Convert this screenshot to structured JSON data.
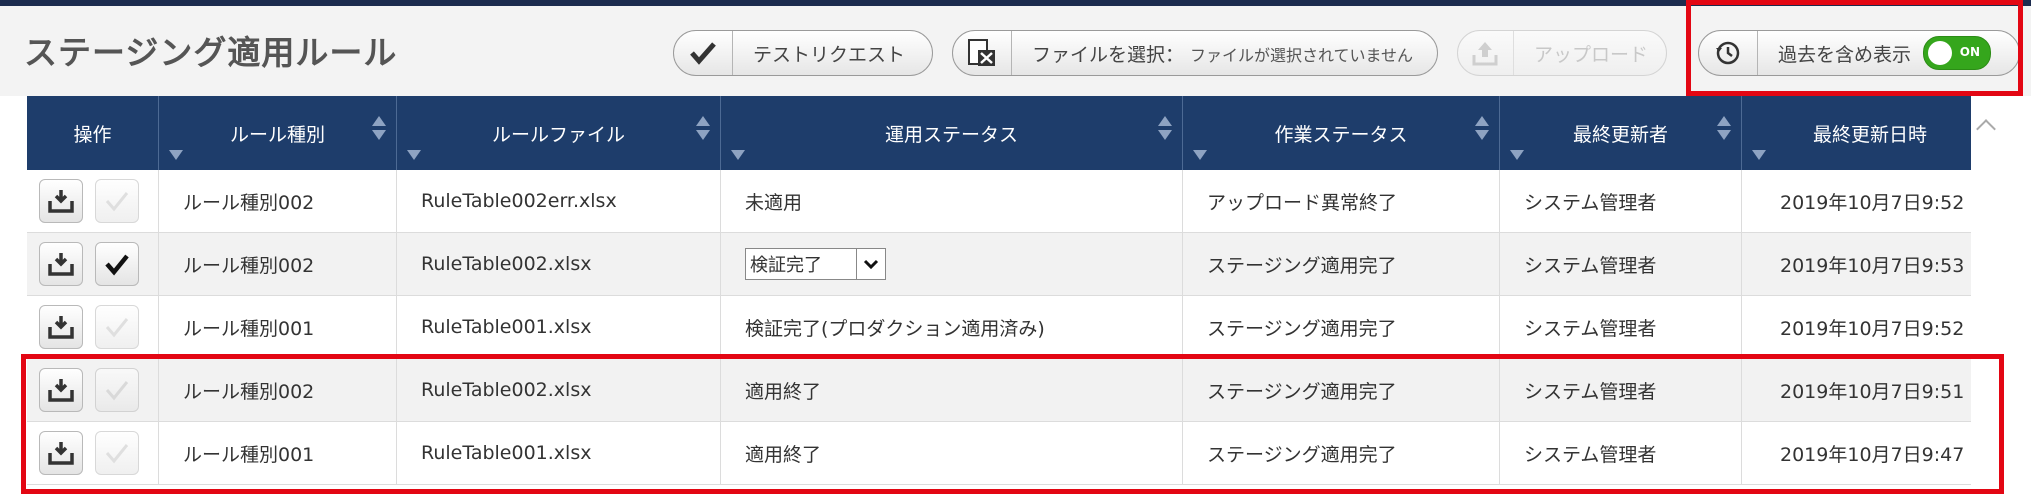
{
  "header": {
    "title": "ステージング適用ルール",
    "test_request_label": "テストリクエスト",
    "file_select_label": "ファイルを選択：",
    "file_select_status": "ファイルが選択されていません",
    "upload_label": "アップロード",
    "show_past_label": "過去を含め表示",
    "toggle_state": "ON"
  },
  "table": {
    "columns": [
      "操作",
      "ルール種別",
      "ルールファイル",
      "運用ステータス",
      "作業ステータス",
      "最終更新者",
      "最終更新日時"
    ],
    "rows": [
      {
        "rule_type": "ルール種別002",
        "rule_file": "RuleTable002err.xlsx",
        "op_status": "未適用",
        "work_status": "アップロード異常終了",
        "updated_by": "システム管理者",
        "updated_at": "2019年10月7日9:52"
      },
      {
        "rule_type": "ルール種別002",
        "rule_file": "RuleTable002.xlsx",
        "op_status": "検証完了",
        "work_status": "ステージング適用完了",
        "updated_by": "システム管理者",
        "updated_at": "2019年10月7日9:53"
      },
      {
        "rule_type": "ルール種別001",
        "rule_file": "RuleTable001.xlsx",
        "op_status": "検証完了(プロダクション適用済み)",
        "work_status": "ステージング適用完了",
        "updated_by": "システム管理者",
        "updated_at": "2019年10月7日9:52"
      },
      {
        "rule_type": "ルール種別002",
        "rule_file": "RuleTable002.xlsx",
        "op_status": "適用終了",
        "work_status": "ステージング適用完了",
        "updated_by": "システム管理者",
        "updated_at": "2019年10月7日9:51"
      },
      {
        "rule_type": "ルール種別001",
        "rule_file": "RuleTable001.xlsx",
        "op_status": "適用終了",
        "work_status": "ステージング適用完了",
        "updated_by": "システム管理者",
        "updated_at": "2019年10月7日9:47"
      }
    ]
  },
  "colors": {
    "header_bg": "#1e3d6b",
    "highlight": "#e30613",
    "toggle_on": "#35a61c"
  }
}
